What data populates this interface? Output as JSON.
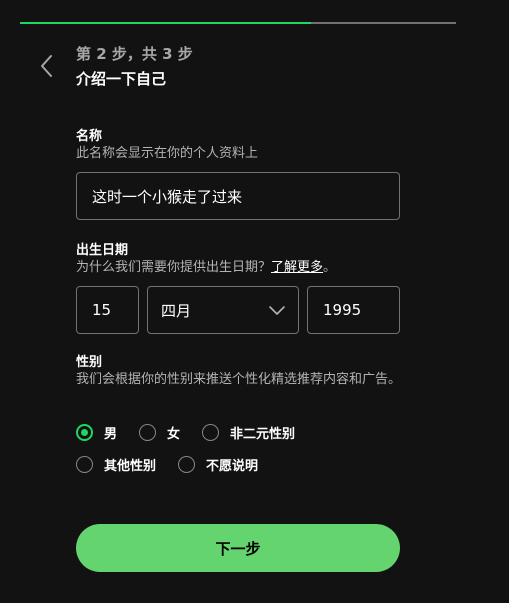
{
  "progress": {
    "fraction": 0.667
  },
  "header": {
    "step_text": "第 2 步，共 3 步",
    "title": "介绍一下自己"
  },
  "name_section": {
    "label": "名称",
    "description": "此名称会显示在你的个人资料上",
    "value": "这时一个小猴走了过来"
  },
  "birthdate_section": {
    "label": "出生日期",
    "description": "为什么我们需要你提供出生日期？",
    "learn_more": "了解更多",
    "description_suffix": "。",
    "day": "15",
    "month": "四月",
    "year": "1995"
  },
  "gender_section": {
    "label": "性别",
    "description": "我们会根据你的性别来推送个性化精选推荐内容和广告。",
    "options": [
      {
        "label": "男",
        "selected": true
      },
      {
        "label": "女",
        "selected": false
      },
      {
        "label": "非二元性别",
        "selected": false
      },
      {
        "label": "其他性别",
        "selected": false
      },
      {
        "label": "不愿说明",
        "selected": false
      }
    ]
  },
  "next_button": {
    "label": "下一步"
  },
  "colors": {
    "accent": "#1ed760",
    "button": "#64d46e",
    "background": "#121212"
  },
  "icons": {
    "back": "chevron-left-icon",
    "dropdown": "chevron-down-icon"
  }
}
